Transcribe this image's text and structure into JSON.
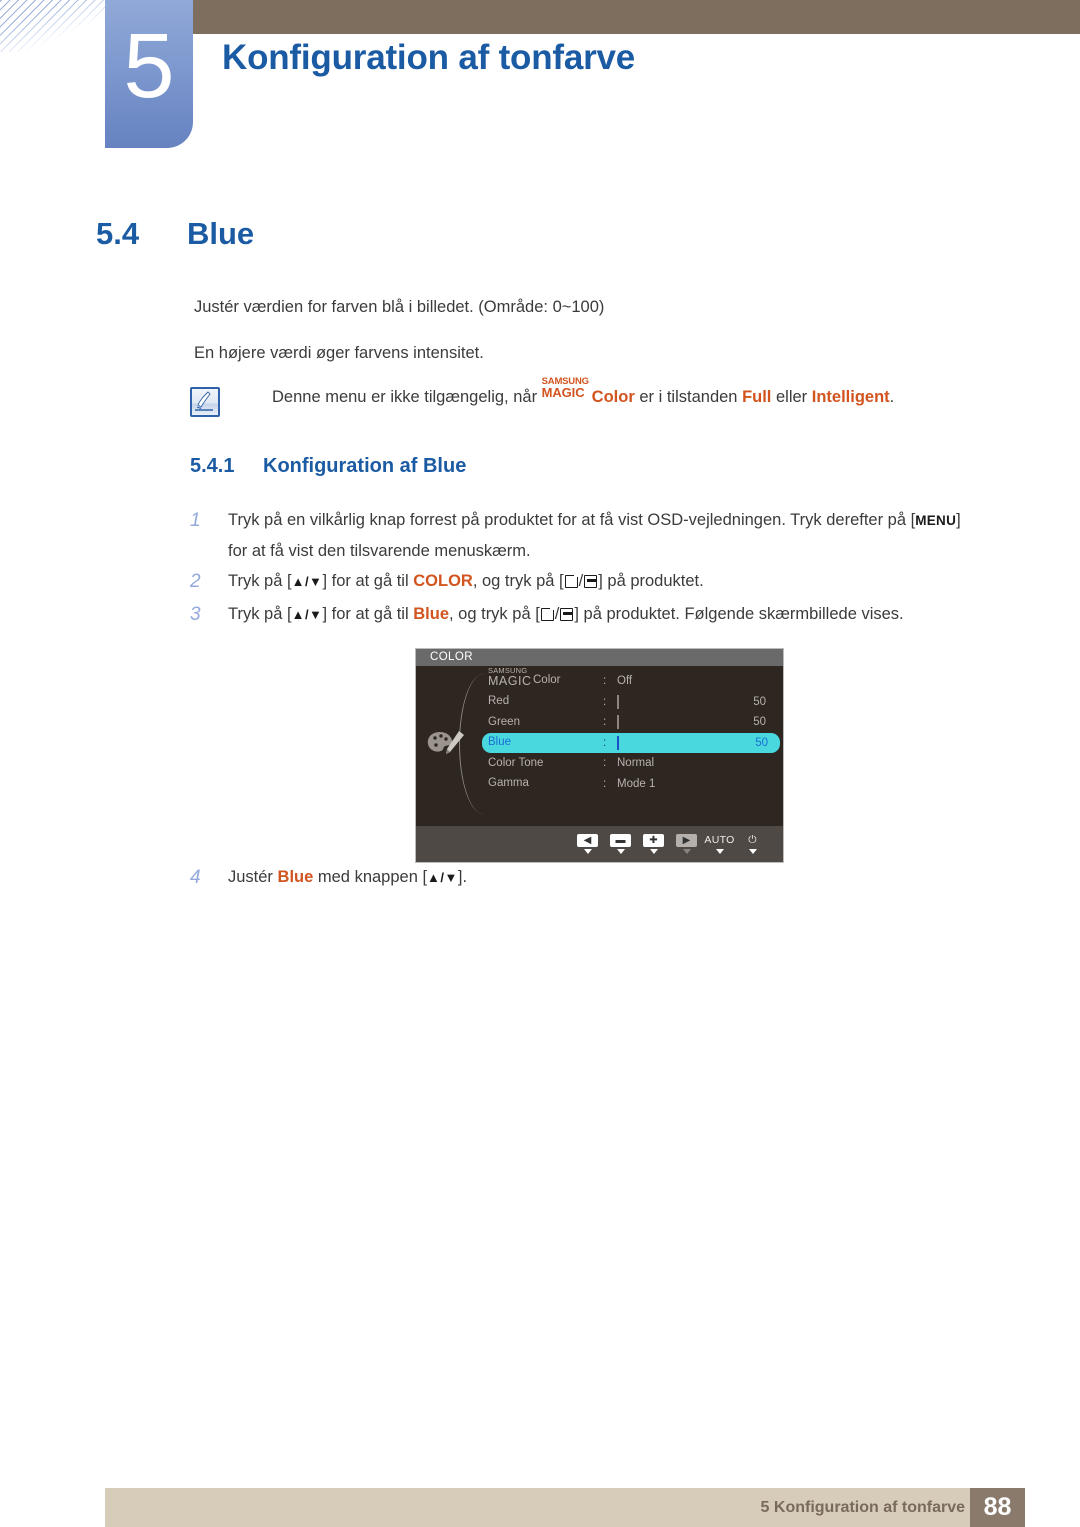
{
  "header": {
    "chapter_number": "5",
    "chapter_title": "Konfiguration af tonfarve"
  },
  "section": {
    "number": "5.4",
    "title": "Blue"
  },
  "body": {
    "paragraph_1": "Justér værdien for farven blå i billedet. (Område: 0~100)",
    "paragraph_2": "En højere værdi øger farvens intensitet."
  },
  "note": {
    "icon": "note-pen-icon",
    "text_before": "Denne menu er ikke tilgængelig, når ",
    "magic_top": "SAMSUNG",
    "magic_bottom": "MAGIC",
    "magic_suffix": "Color",
    "text_middle": " er i tilstanden ",
    "highlight_1": "Full",
    "text_between": " eller ",
    "highlight_2": "Intelligent",
    "text_end": "."
  },
  "subsection": {
    "number": "5.4.1",
    "title": "Konfiguration af Blue"
  },
  "steps": [
    {
      "number": "1",
      "text_a": "Tryk på en vilkårlig knap forrest på produktet for at få vist OSD-vejledningen. Tryk derefter på [",
      "key": "MENU",
      "text_b": "]",
      "line2": "for at få vist den tilsvarende menuskærm."
    },
    {
      "number": "2",
      "text_a": "Tryk på [",
      "arrows": "▲/▼",
      "text_b": "] for at gå til ",
      "target": "COLOR",
      "text_c": ", og tryk på [",
      "text_d": "/",
      "text_e": "] på produktet."
    },
    {
      "number": "3",
      "text_a": "Tryk på [",
      "arrows": "▲/▼",
      "text_b": "] for at gå til ",
      "target": "Blue",
      "text_c": ", og tryk på [",
      "text_d": "/",
      "text_e": "] på produktet. Følgende skærmbillede vises."
    },
    {
      "number": "4",
      "text_a": "Justér ",
      "target": "Blue",
      "text_b": " med knappen [",
      "arrows": "▲/▼",
      "text_c": "]."
    }
  ],
  "osd": {
    "title": "COLOR",
    "palette_icon": "palette-icon",
    "rows": [
      {
        "label_top": "SAMSUNG",
        "label_bottom": "MAGIC",
        "label_suffix": "Color",
        "type": "text",
        "value": "Off"
      },
      {
        "label": "Red",
        "type": "slider",
        "value": 50,
        "display": "50"
      },
      {
        "label": "Green",
        "type": "slider",
        "value": 50,
        "display": "50"
      },
      {
        "label": "Blue",
        "type": "slider",
        "value": 50,
        "display": "50",
        "selected": true
      },
      {
        "label": "Color Tone",
        "type": "text",
        "value": "Normal"
      },
      {
        "label": "Gamma",
        "type": "text",
        "value": "Mode 1"
      }
    ],
    "buttons": [
      {
        "name": "left-arrow-button",
        "glyph": "◀"
      },
      {
        "name": "minus-button",
        "glyph": "▬"
      },
      {
        "name": "plus-button",
        "glyph": "✚"
      },
      {
        "name": "right-arrow-button",
        "glyph": "▶"
      },
      {
        "name": "auto-button",
        "glyph": "AUTO"
      },
      {
        "name": "power-button",
        "glyph": "⏻"
      }
    ]
  },
  "footer": {
    "text": "5 Konfiguration af tonfarve",
    "page_number": "88"
  },
  "colors": {
    "accent_blue": "#1b5ba4",
    "orange": "#d2541f",
    "header_brown": "#7d6e5e",
    "footer_beige": "#d7cbba",
    "osd_highlight": "#49d8dd"
  }
}
